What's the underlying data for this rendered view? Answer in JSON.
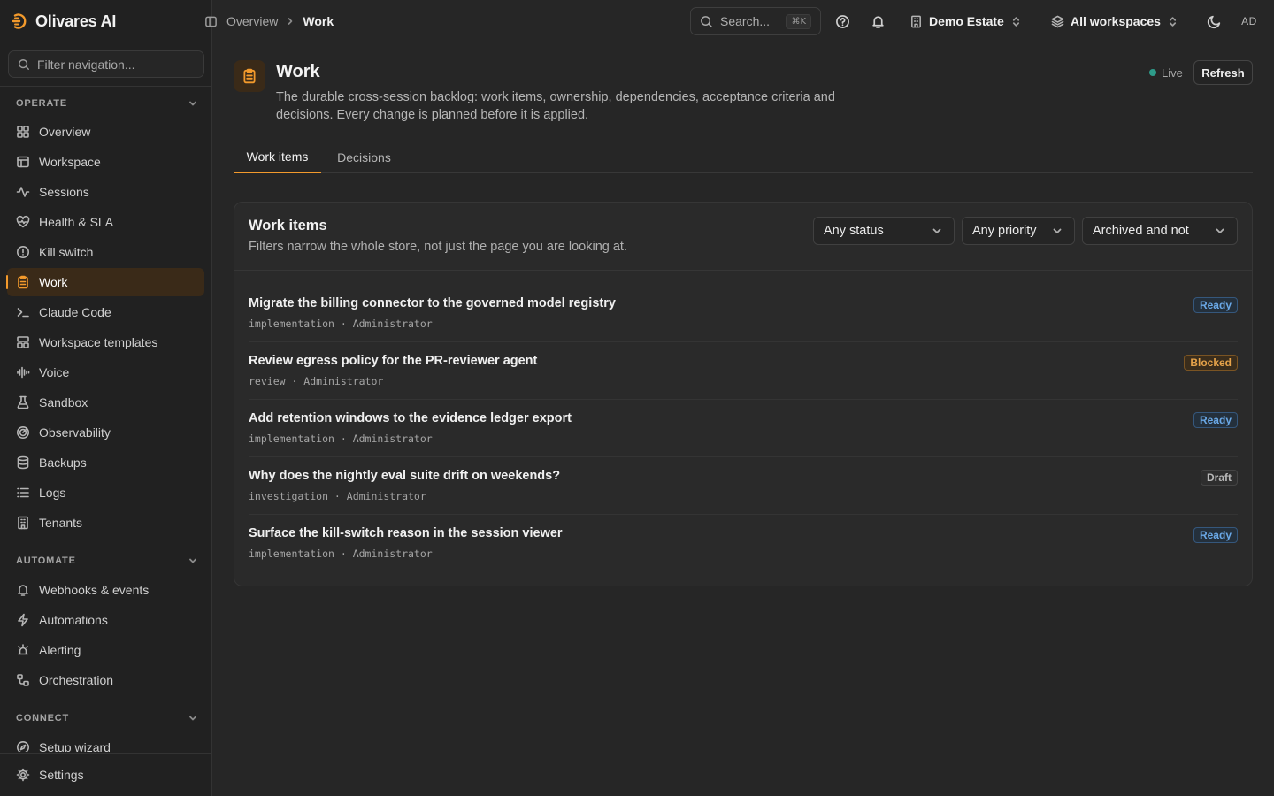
{
  "app": {
    "name": "Olivares AI"
  },
  "sidebar": {
    "filter_placeholder": "Filter navigation...",
    "sections": [
      {
        "title": "OPERATE",
        "items": [
          {
            "label": "Overview",
            "icon": "grid-icon"
          },
          {
            "label": "Workspace",
            "icon": "layout-icon"
          },
          {
            "label": "Sessions",
            "icon": "activity-icon"
          },
          {
            "label": "Health & SLA",
            "icon": "heart-pulse-icon"
          },
          {
            "label": "Kill switch",
            "icon": "alert-circle-icon"
          },
          {
            "label": "Work",
            "icon": "clipboard-icon",
            "active": true
          },
          {
            "label": "Claude Code",
            "icon": "terminal-icon"
          },
          {
            "label": "Workspace templates",
            "icon": "templates-icon"
          },
          {
            "label": "Voice",
            "icon": "audio-waveform-icon"
          },
          {
            "label": "Sandbox",
            "icon": "flask-icon"
          },
          {
            "label": "Observability",
            "icon": "radar-icon"
          },
          {
            "label": "Backups",
            "icon": "database-icon"
          },
          {
            "label": "Logs",
            "icon": "list-icon"
          },
          {
            "label": "Tenants",
            "icon": "building-icon"
          }
        ]
      },
      {
        "title": "AUTOMATE",
        "items": [
          {
            "label": "Webhooks & events",
            "icon": "bell-icon"
          },
          {
            "label": "Automations",
            "icon": "zap-icon"
          },
          {
            "label": "Alerting",
            "icon": "siren-icon"
          },
          {
            "label": "Orchestration",
            "icon": "workflow-icon"
          }
        ]
      },
      {
        "title": "CONNECT",
        "items": [
          {
            "label": "Setup wizard",
            "icon": "compass-icon"
          }
        ]
      }
    ],
    "footer": {
      "label": "Settings",
      "icon": "gear-icon"
    }
  },
  "topbar": {
    "breadcrumb": [
      "Overview",
      "Work"
    ],
    "search_label": "Search...",
    "search_shortcut": "⌘K",
    "estate": "Demo Estate",
    "workspace": "All workspaces",
    "avatar_initials": "AD"
  },
  "page": {
    "title": "Work",
    "description": "The durable cross-session backlog: work items, ownership, dependencies, acceptance criteria and decisions. Every change is planned before it is applied.",
    "live_label": "Live",
    "refresh_label": "Refresh",
    "tabs": [
      "Work items",
      "Decisions"
    ]
  },
  "card": {
    "title": "Work items",
    "subtitle": "Filters narrow the whole store, not just the page you are looking at.",
    "filters": {
      "status": "Any status",
      "priority": "Any priority",
      "archived": "Archived and not"
    },
    "items": [
      {
        "title": "Migrate the billing connector to the governed model registry",
        "meta": "implementation · Administrator",
        "status": "Ready"
      },
      {
        "title": "Review egress policy for the PR-reviewer agent",
        "meta": "review · Administrator",
        "status": "Blocked"
      },
      {
        "title": "Add retention windows to the evidence ledger export",
        "meta": "implementation · Administrator",
        "status": "Ready"
      },
      {
        "title": "Why does the nightly eval suite drift on weekends?",
        "meta": "investigation · Administrator",
        "status": "Draft"
      },
      {
        "title": "Surface the kill-switch reason in the session viewer",
        "meta": "implementation · Administrator",
        "status": "Ready"
      }
    ]
  },
  "colors": {
    "accent": "#f39a2c",
    "ready": "#6aa8e6",
    "blocked": "#e6a34a",
    "live": "#2e9c8a"
  }
}
